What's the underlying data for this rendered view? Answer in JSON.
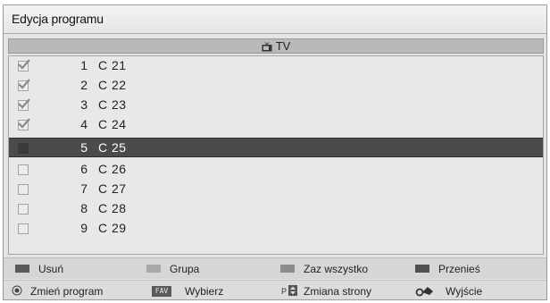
{
  "window": {
    "title": "Edycja programu"
  },
  "list": {
    "header": "TV",
    "header_icon": "tv-icon",
    "rows": [
      {
        "num": "1",
        "name": "C 21",
        "checked": true,
        "selected": false
      },
      {
        "num": "2",
        "name": "C 22",
        "checked": true,
        "selected": false
      },
      {
        "num": "3",
        "name": "C 23",
        "checked": true,
        "selected": false
      },
      {
        "num": "4",
        "name": "C 24",
        "checked": true,
        "selected": false
      },
      {
        "num": "5",
        "name": "C 25",
        "checked": false,
        "selected": true
      },
      {
        "num": "6",
        "name": "C 26",
        "checked": false,
        "selected": false
      },
      {
        "num": "7",
        "name": "C 27",
        "checked": false,
        "selected": false
      },
      {
        "num": "8",
        "name": "C 28",
        "checked": false,
        "selected": false
      },
      {
        "num": "9",
        "name": "C 29",
        "checked": false,
        "selected": false
      }
    ]
  },
  "color_keys": [
    {
      "label": "Usuń",
      "color": "#5a5a5a"
    },
    {
      "label": "Grupa",
      "color": "#a8a8a8"
    },
    {
      "label": "Zaz wszystko",
      "color": "#8c8c8c"
    },
    {
      "label": "Przenieś",
      "color": "#505050"
    }
  ],
  "hints": [
    {
      "icon": "ok-button-icon",
      "label": "Zmień program"
    },
    {
      "icon": "fav-button-icon",
      "badge": "FAV",
      "label": "Wybierz"
    },
    {
      "icon": "page-up-down-icon",
      "label": "Zmiana strony"
    },
    {
      "icon": "exit-icon",
      "label": "Wyjście"
    }
  ]
}
